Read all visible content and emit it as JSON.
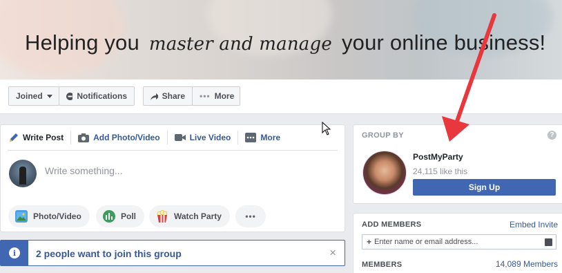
{
  "cover": {
    "title_part1": "Helping you",
    "title_script": "master and manage",
    "title_part2": "your online business!"
  },
  "actions": {
    "joined": "Joined",
    "notifications": "Notifications",
    "share": "Share",
    "more": "More"
  },
  "composer": {
    "tabs": [
      {
        "label": "Write Post",
        "icon": "pencil-icon"
      },
      {
        "label": "Add Photo/Video",
        "icon": "camera-icon"
      },
      {
        "label": "Live Video",
        "icon": "video-camera-icon"
      },
      {
        "label": "More",
        "icon": "ellipsis-icon"
      }
    ],
    "placeholder": "Write something...",
    "buttons": [
      {
        "label": "Photo/Video",
        "icon": "photo-icon"
      },
      {
        "label": "Poll",
        "icon": "poll-icon"
      },
      {
        "label": "Watch Party",
        "icon": "popcorn-icon"
      },
      {
        "label": "",
        "icon": "more-dots-icon"
      }
    ]
  },
  "join_banner": {
    "text": "2 people want to join this group",
    "close": "×"
  },
  "group_by": {
    "header": "GROUP BY",
    "page_name": "PostMyParty",
    "likes": "24,115 like this",
    "signup": "Sign Up"
  },
  "add_members": {
    "header": "ADD MEMBERS",
    "embed": "Embed Invite",
    "input_placeholder": "Enter name or email address...",
    "members_header": "MEMBERS",
    "members_count": "14,089 Members"
  },
  "colors": {
    "brand": "#4267b2",
    "link": "#365899",
    "annotation_arrow": "#e8383d"
  }
}
